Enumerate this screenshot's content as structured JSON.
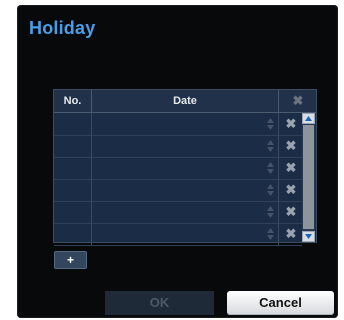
{
  "dialog": {
    "title": "Holiday"
  },
  "table": {
    "headers": {
      "no": "No.",
      "date": "Date",
      "delete_icon": "close-icon"
    },
    "rows": [
      {
        "no": "",
        "date": ""
      },
      {
        "no": "",
        "date": ""
      },
      {
        "no": "",
        "date": ""
      },
      {
        "no": "",
        "date": ""
      },
      {
        "no": "",
        "date": ""
      },
      {
        "no": "",
        "date": ""
      }
    ]
  },
  "buttons": {
    "add": "+",
    "ok": "OK",
    "cancel": "Cancel"
  },
  "colors": {
    "title": "#4a9ee8",
    "table_bg": "#1b2d46",
    "dialog_bg": "#08090b"
  }
}
